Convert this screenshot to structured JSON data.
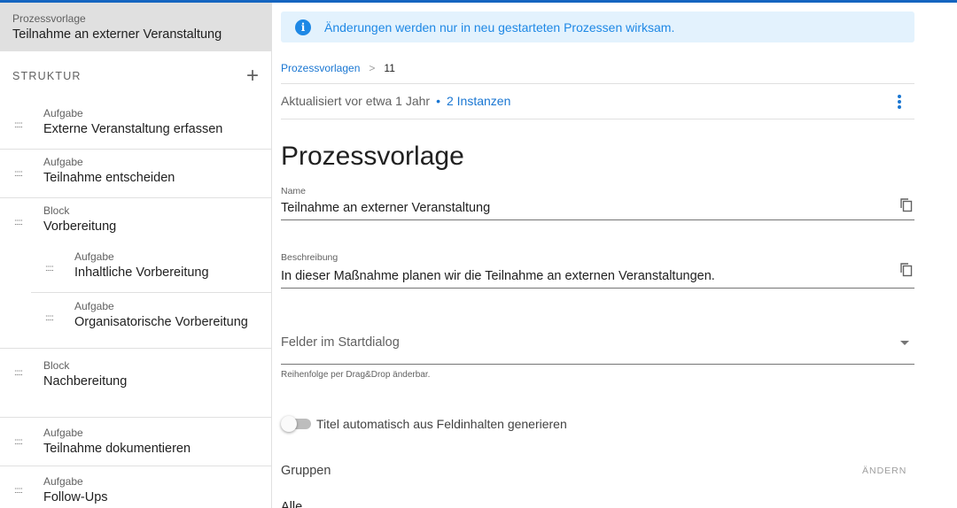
{
  "sidebar": {
    "header_sub": "Prozessvorlage",
    "header_title": "Teilnahme an externer Veranstaltung",
    "structure_label": "STRUKTUR",
    "add_icon": "plus-icon",
    "items": [
      {
        "type": "Aufgabe",
        "name": "Externe Veranstaltung erfassen"
      },
      {
        "type": "Aufgabe",
        "name": "Teilnahme entscheiden"
      },
      {
        "type": "Block",
        "name": "Vorbereitung"
      },
      {
        "type": "Aufgabe",
        "name": "Inhaltliche Vorbereitung"
      },
      {
        "type": "Aufgabe",
        "name": "Organisatorische Vorbereitung"
      },
      {
        "type": "Block",
        "name": "Nachbereitung"
      },
      {
        "type": "Aufgabe",
        "name": "Teilnahme dokumentieren"
      },
      {
        "type": "Aufgabe",
        "name": "Follow-Ups"
      }
    ]
  },
  "main": {
    "info_text": "Änderungen werden nur in neu gestarteten Prozessen wirksam.",
    "breadcrumb": {
      "link": "Prozessvorlagen",
      "separator": ">",
      "current": "11"
    },
    "meta": {
      "updated": "Aktualisiert vor etwa 1 Jahr",
      "dot": "•",
      "instances": "2 Instanzen"
    },
    "page_title": "Prozessvorlage",
    "name_field": {
      "label": "Name",
      "value": "Teilnahme an externer Veranstaltung"
    },
    "description_field": {
      "label": "Beschreibung",
      "value": "In dieser Maßnahme planen wir die Teilnahme an externen Veranstaltungen."
    },
    "start_dialog_select": {
      "placeholder": "Felder im Startdialog",
      "hint": "Reihenfolge per Drag&Drop änderbar."
    },
    "toggle": {
      "label": "Titel automatisch aus Feldinhalten generieren",
      "checked": false
    },
    "groups": {
      "label": "Gruppen",
      "change_button": "ÄNDERN",
      "value": "Alle"
    }
  },
  "colors": {
    "accent": "#1976d2",
    "info_bg": "#e3f2fd",
    "header_bg": "#e0e0e0",
    "topline": "#1565c0"
  }
}
